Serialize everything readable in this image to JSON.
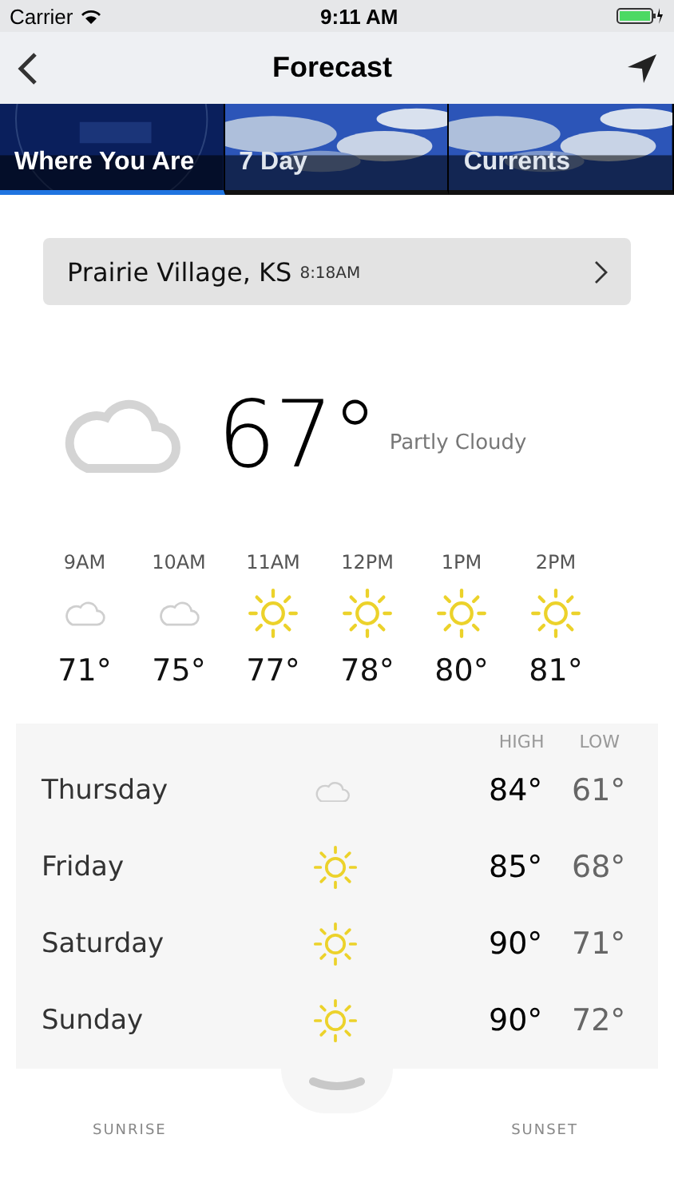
{
  "status_bar": {
    "carrier": "Carrier",
    "time": "9:11 AM"
  },
  "nav": {
    "title": "Forecast"
  },
  "tabs": [
    {
      "label": "Where You Are",
      "selected": true
    },
    {
      "label": "7 Day",
      "selected": false
    },
    {
      "label": "Currents",
      "selected": false
    }
  ],
  "location": {
    "name": "Prairie Village, KS",
    "time": "8:18AM"
  },
  "current": {
    "temp": "67°",
    "condition": "Partly Cloudy",
    "kind": "cloud"
  },
  "hourly": [
    {
      "time": "9AM",
      "kind": "cloud",
      "temp": "71°"
    },
    {
      "time": "10AM",
      "kind": "cloud",
      "temp": "75°"
    },
    {
      "time": "11AM",
      "kind": "sun",
      "temp": "77°"
    },
    {
      "time": "12PM",
      "kind": "sun",
      "temp": "78°"
    },
    {
      "time": "1PM",
      "kind": "sun",
      "temp": "80°"
    },
    {
      "time": "2PM",
      "kind": "sun",
      "temp": "81°"
    }
  ],
  "daily": {
    "high_label": "HIGH",
    "low_label": "LOW",
    "days": [
      {
        "day": "Thursday",
        "kind": "cloud",
        "high": "84°",
        "low": "61°"
      },
      {
        "day": "Friday",
        "kind": "sun",
        "high": "85°",
        "low": "68°"
      },
      {
        "day": "Saturday",
        "kind": "sun",
        "high": "90°",
        "low": "71°"
      },
      {
        "day": "Sunday",
        "kind": "sun",
        "high": "90°",
        "low": "72°"
      }
    ]
  },
  "sun_times": {
    "sunrise_label": "SUNRISE",
    "sunset_label": "SUNSET"
  }
}
